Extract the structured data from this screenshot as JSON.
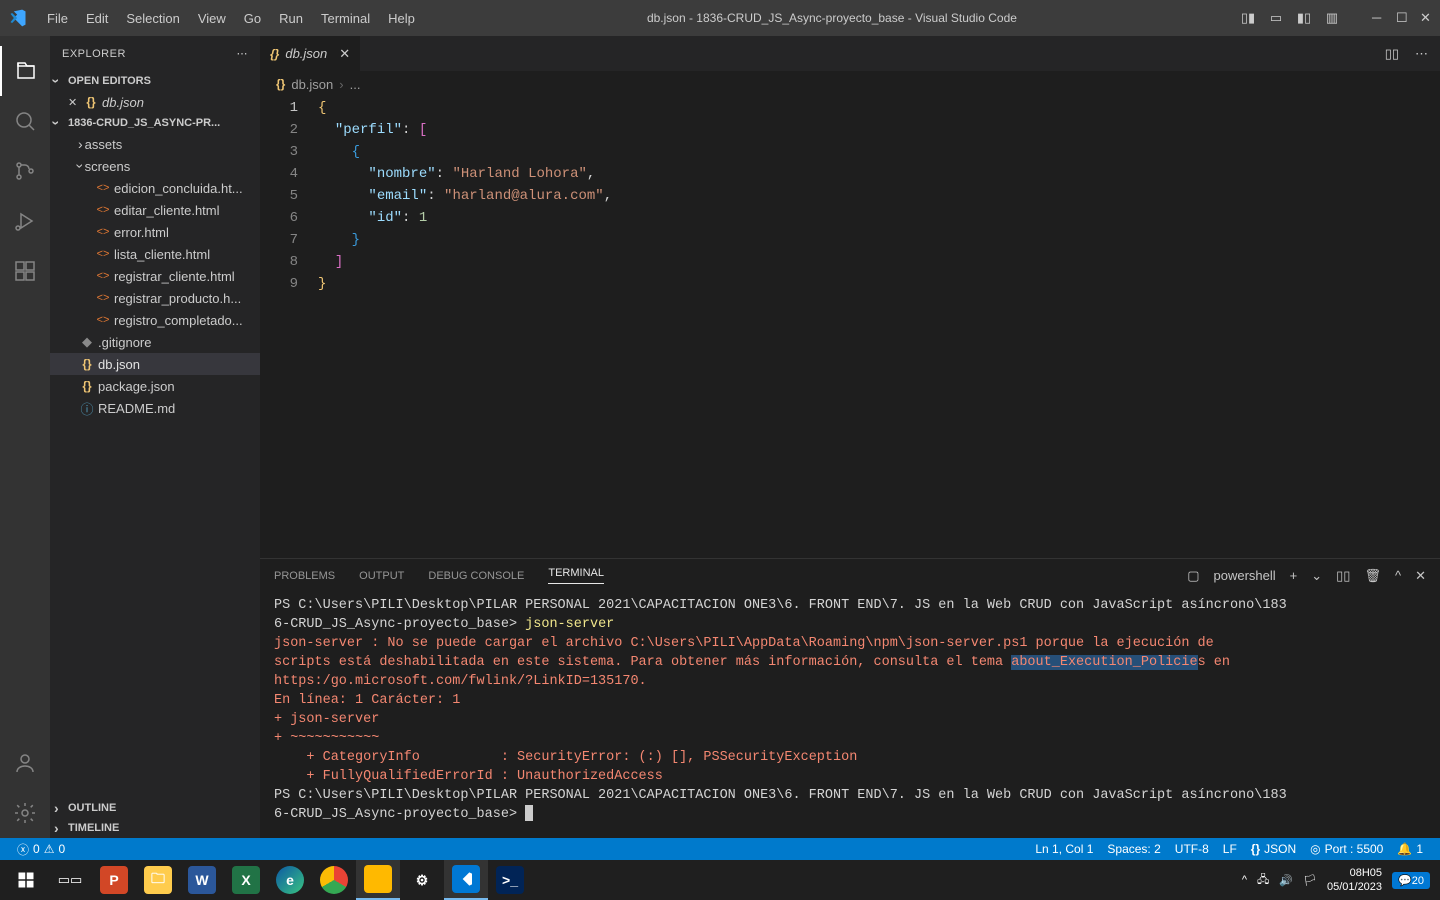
{
  "window": {
    "title": "db.json - 1836-CRUD_JS_Async-proyecto_base - Visual Studio Code"
  },
  "menu": [
    "File",
    "Edit",
    "Selection",
    "View",
    "Go",
    "Run",
    "Terminal",
    "Help"
  ],
  "explorer": {
    "title": "EXPLORER",
    "open_editors_label": "OPEN EDITORS",
    "open_file": "db.json",
    "project_label": "1836-CRUD_JS_ASYNC-PR...",
    "folders": {
      "assets": "assets",
      "screens": "screens"
    },
    "files": {
      "f0": "edicion_concluida.ht...",
      "f1": "editar_cliente.html",
      "f2": "error.html",
      "f3": "lista_cliente.html",
      "f4": "registrar_cliente.html",
      "f5": "registrar_producto.h...",
      "f6": "registro_completado...",
      "f7": ".gitignore",
      "f8": "db.json",
      "f9": "package.json",
      "f10": "README.md"
    },
    "outline": "OUTLINE",
    "timeline": "TIMELINE"
  },
  "tabs": {
    "active": "db.json"
  },
  "breadcrumb": {
    "file": "db.json",
    "more": "..."
  },
  "code": {
    "lines": [
      "1",
      "2",
      "3",
      "4",
      "5",
      "6",
      "7",
      "8",
      "9"
    ],
    "l2_key": "\"perfil\"",
    "l4_key": "\"nombre\"",
    "l4_val": "\"Harland Lohora\"",
    "l5_key": "\"email\"",
    "l5_val": "\"harland@alura.com\"",
    "l6_key": "\"id\"",
    "l6_val": "1"
  },
  "panel": {
    "tabs": [
      "PROBLEMS",
      "OUTPUT",
      "DEBUG CONSOLE",
      "TERMINAL"
    ],
    "shell": "powershell",
    "prompt1a": "PS C:\\Users\\PILI\\Desktop\\PILAR PERSONAL 2021\\CAPACITACION ONE3\\6. FRONT END\\7. JS en la Web CRUD con JavaScript asíncrono\\183",
    "prompt1b": "6-CRUD_JS_Async-proyecto_base> ",
    "cmd": "json-server",
    "err1": "json-server : No se puede cargar el archivo C:\\Users\\PILI\\AppData\\Roaming\\npm\\json-server.ps1 porque la ejecución de ",
    "err2a": "scripts está deshabilitada en este sistema. Para obtener más información, consulta el tema ",
    "err2sel": "about_Execution_Policie",
    "err2b": "s en ",
    "err3": "https:/go.microsoft.com/fwlink/?LinkID=135170.",
    "err4": "En línea: 1 Carácter: 1",
    "err5": "+ json-server",
    "err6": "+ ~~~~~~~~~~~",
    "err7": "    + CategoryInfo          : SecurityError: (:) [], PSSecurityException",
    "err8": "    + FullyQualifiedErrorId : UnauthorizedAccess",
    "prompt2a": "PS C:\\Users\\PILI\\Desktop\\PILAR PERSONAL 2021\\CAPACITACION ONE3\\6. FRONT END\\7. JS en la Web CRUD con JavaScript asíncrono\\183",
    "prompt2b": "6-CRUD_JS_Async-proyecto_base> "
  },
  "status": {
    "errors": "0",
    "warnings": "0",
    "ln_col": "Ln 1, Col 1",
    "spaces": "Spaces: 2",
    "encoding": "UTF-8",
    "eol": "LF",
    "lang": "JSON",
    "port": "Port : 5500",
    "bell": "1"
  },
  "taskbar": {
    "time": "08H05",
    "date": "05/01/2023",
    "notif": "20"
  }
}
